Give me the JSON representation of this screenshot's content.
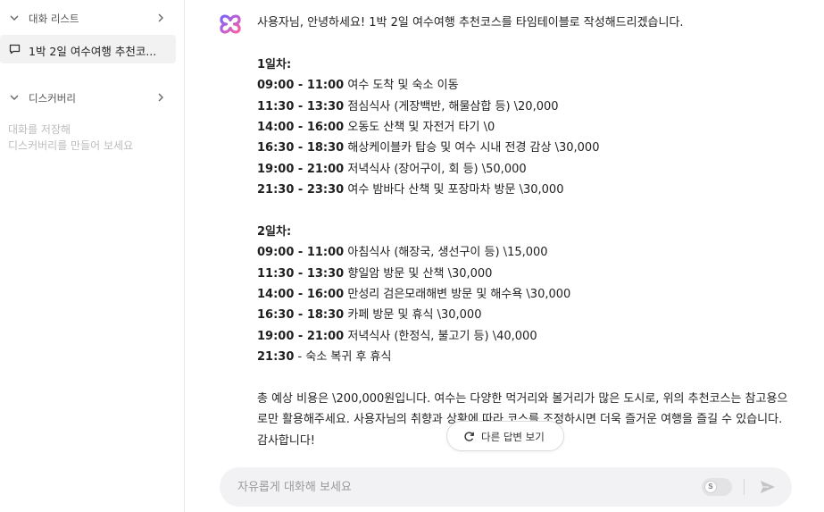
{
  "sidebar": {
    "chat_list_label": "대화 리스트",
    "active_chat_title": "1박 2일 여수여행 추천코...",
    "discovery_label": "디스커버리",
    "discovery_note_line1": "대화를 저장해",
    "discovery_note_line2": "디스커버리를 만들어 보세요"
  },
  "answer": {
    "greeting": "사용자님, 안녕하세요! 1박 2일 여수여행 추천코스를 타임테이블로 작성해드리겠습니다.",
    "days": [
      {
        "title": "1일차",
        "items": [
          {
            "time": "09:00 - 11:00",
            "desc": "여수 도착 및 숙소 이동"
          },
          {
            "time": "11:30 - 13:30",
            "desc": "점심식사 (게장백반, 해물삼합 등) \\20,000"
          },
          {
            "time": "14:00 - 16:00",
            "desc": "오동도 산책 및 자전거 타기 \\0"
          },
          {
            "time": "16:30 - 18:30",
            "desc": "해상케이블카 탑승 및 여수 시내 전경 감상 \\30,000"
          },
          {
            "time": "19:00 - 21:00",
            "desc": "저녁식사 (장어구이, 회 등) \\50,000"
          },
          {
            "time": "21:30 - 23:30",
            "desc": "여수 밤바다 산책 및 포장마차 방문 \\30,000"
          }
        ]
      },
      {
        "title": "2일차",
        "items": [
          {
            "time": "09:00 - 11:00",
            "desc": "아침식사 (해장국, 생선구이 등) \\15,000"
          },
          {
            "time": "11:30 - 13:30",
            "desc": "향일암 방문 및 산책 \\30,000"
          },
          {
            "time": "14:00 - 16:00",
            "desc": "만성리 검은모래해변 방문 및 해수욕 \\30,000"
          },
          {
            "time": "16:30 - 18:30",
            "desc": "카페 방문 및 휴식 \\30,000"
          },
          {
            "time": "19:00 - 21:00",
            "desc": "저녁식사 (한정식, 불고기 등) \\40,000"
          },
          {
            "time": "21:30",
            "desc": "- 숙소 복귀 후 휴식"
          }
        ]
      }
    ],
    "closing": "총 예상 비용은 \\200,000원입니다. 여수는 다양한 먹거리와 볼거리가 많은 도시로, 위의 추천코스는 참고용으로만 활용해주세요. 사용자님의 취향과 상황에 따라 코스를 조정하시면 더욱 즐거운 여행을 즐길 수 있습니다. 감사합니다!"
  },
  "regenerate_label": "다른 답변 보기",
  "input": {
    "placeholder": "자유롭게 대화해 보세요"
  },
  "toggle_letter": "S",
  "icons": {
    "chat_list": "chevron-down-icon",
    "chat_list_expand": "chevron-right-icon",
    "chat": "chat-bubble-icon",
    "discovery": "chevron-down-icon",
    "discovery_expand": "chevron-right-icon",
    "assistant": "clover-logo-icon",
    "regenerate": "refresh-icon",
    "send": "send-icon"
  },
  "colors": {
    "logo_start": "#7b61ff",
    "logo_end": "#ff5fa2",
    "active_item_bg": "#f2f2f3",
    "input_bg": "#f2f2f4"
  }
}
